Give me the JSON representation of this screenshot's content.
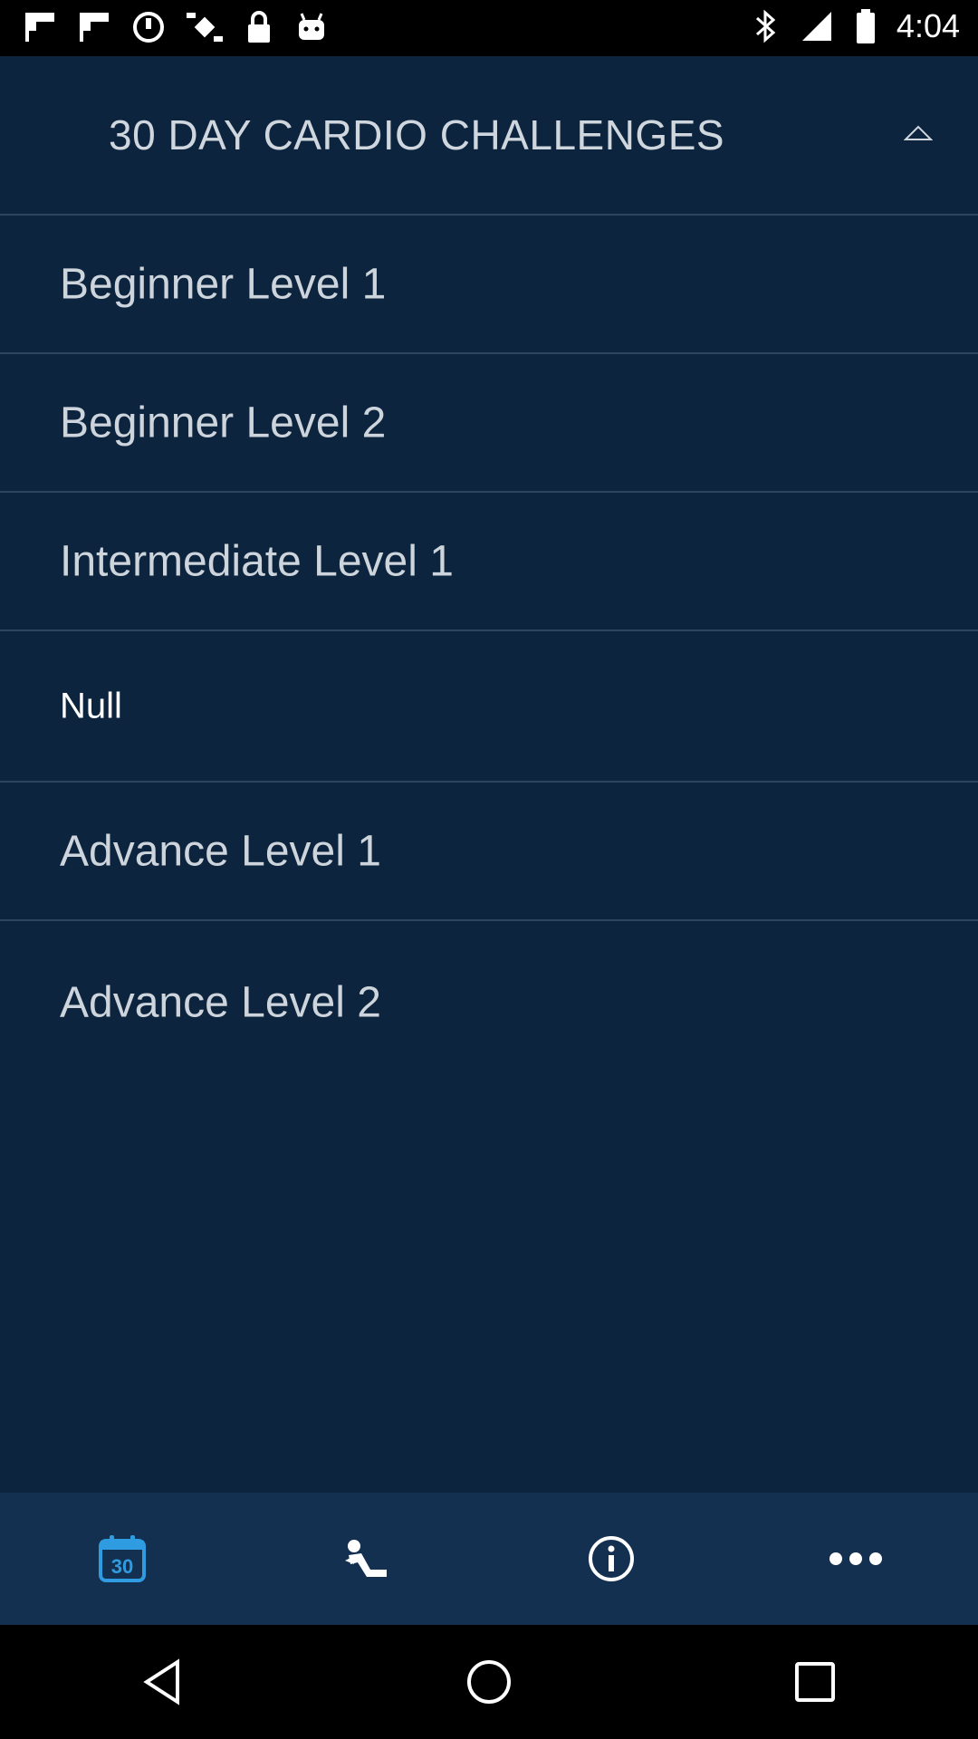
{
  "status_bar": {
    "time": "4:04"
  },
  "header": {
    "title": "30 DAY CARDIO CHALLENGES"
  },
  "list": {
    "items": [
      {
        "label": "Beginner Level 1"
      },
      {
        "label": "Beginner Level 2"
      },
      {
        "label": "Intermediate Level 1"
      },
      {
        "label": "Null"
      },
      {
        "label": "Advance Level 1"
      },
      {
        "label": "Advance Level 2"
      }
    ]
  },
  "bottom_nav": {
    "items": [
      {
        "icon": "calendar-30-icon",
        "text": "30",
        "active": true
      },
      {
        "icon": "exercise-icon",
        "active": false
      },
      {
        "icon": "info-icon",
        "active": false
      },
      {
        "icon": "more-icon",
        "active": false
      }
    ]
  },
  "colors": {
    "background": "#0c243e",
    "nav_background": "#143050",
    "active_icon": "#2f9be0",
    "divider": "#2d4560"
  }
}
